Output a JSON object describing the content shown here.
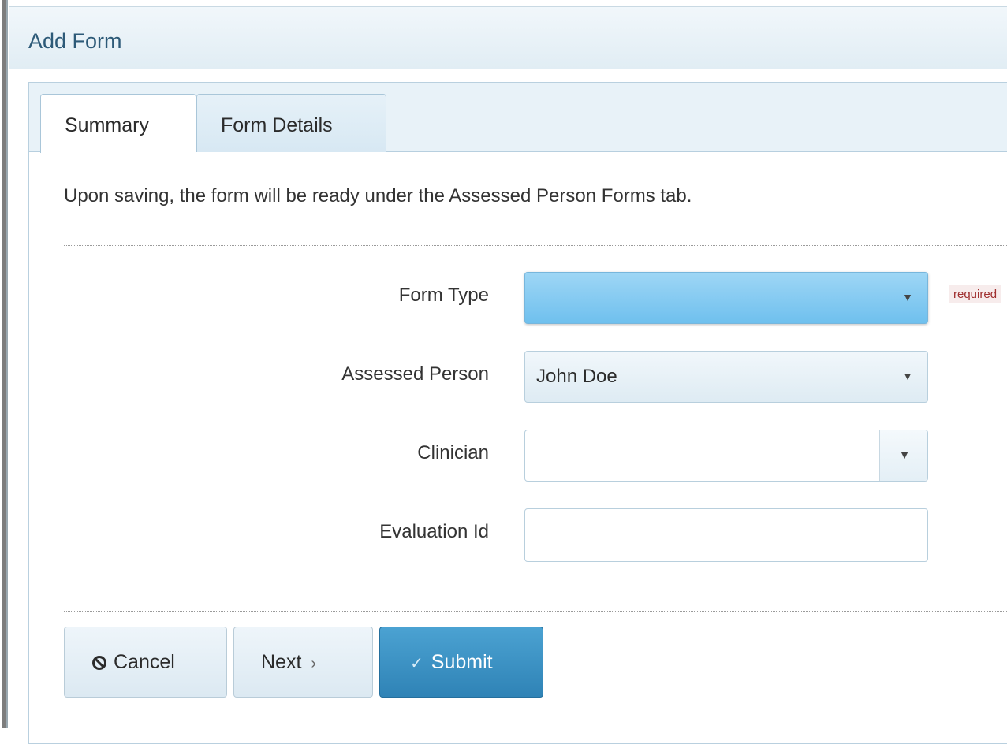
{
  "dialog": {
    "title": "Add Form"
  },
  "tabs": [
    {
      "label": "Summary",
      "active": true
    },
    {
      "label": "Form Details",
      "active": false
    }
  ],
  "info_text": "Upon saving, the form will be ready under the Assessed Person Forms tab.",
  "fields": {
    "form_type": {
      "label": "Form Type",
      "value": "",
      "required_hint": "required"
    },
    "assessed_person": {
      "label": "Assessed Person",
      "value": "John Doe"
    },
    "clinician": {
      "label": "Clinician",
      "value": ""
    },
    "evaluation_id": {
      "label": "Evaluation Id",
      "value": ""
    }
  },
  "buttons": {
    "cancel": "Cancel",
    "next": "Next",
    "submit": "Submit"
  },
  "icons": {
    "cancel": "ban-icon",
    "next": "chevron-right-icon",
    "submit": "checkmark-icon",
    "dropdown": "caret-down-icon"
  },
  "colors": {
    "accent": "#3a90c4",
    "title_text": "#2d5a78",
    "form_type_highlight": "#8fd0f2",
    "required_text": "#a03030"
  }
}
